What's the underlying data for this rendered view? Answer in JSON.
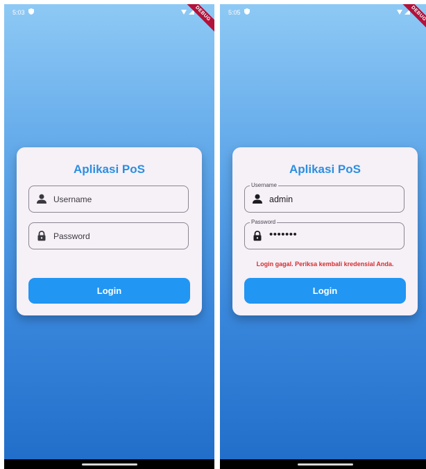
{
  "screens": [
    {
      "status_time": "5:03",
      "debug_label": "DEBUG",
      "card": {
        "title": "Aplikasi PoS",
        "username": {
          "label": "",
          "placeholder": "Username",
          "value": ""
        },
        "password": {
          "label": "",
          "placeholder": "Password",
          "value": ""
        },
        "error": "",
        "login_label": "Login"
      }
    },
    {
      "status_time": "5:05",
      "debug_label": "DEBUG",
      "card": {
        "title": "Aplikasi PoS",
        "username": {
          "label": "Username",
          "placeholder": "",
          "value": "admin"
        },
        "password": {
          "label": "Password",
          "placeholder": "",
          "value": "•••••••"
        },
        "error": "Login gagal. Periksa kembali kredensial Anda.",
        "login_label": "Login"
      }
    }
  ],
  "colors": {
    "accent": "#2196f3",
    "title": "#2b8fe0",
    "error": "#d32f2f",
    "card_bg": "#f6f0f7",
    "debug_banner": "#b0123c"
  },
  "icons": {
    "status_left": "shield-icon",
    "status_right": [
      "wifi-icon",
      "signal-icon",
      "battery-icon"
    ],
    "username_field": "person-icon",
    "password_field": "lock-icon"
  }
}
